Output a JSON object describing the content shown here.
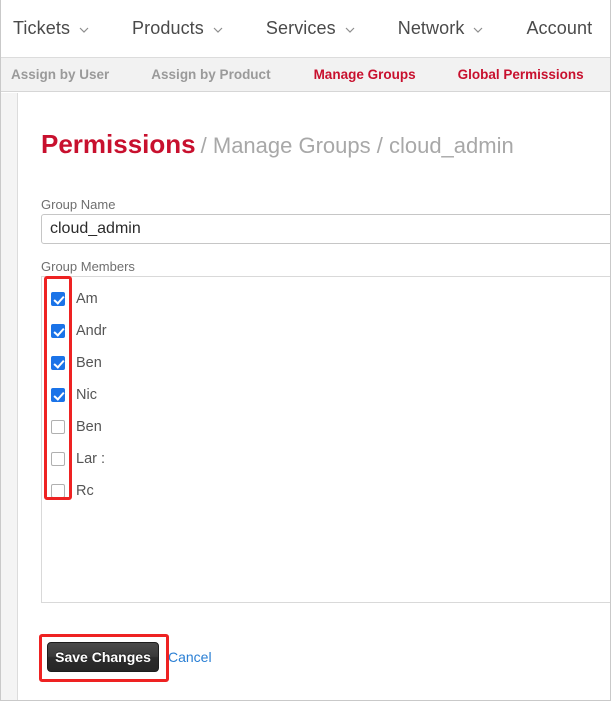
{
  "topnav": {
    "items": [
      {
        "label": "Tickets",
        "has_caret": true,
        "icon": "chevron-down-icon"
      },
      {
        "label": "Products",
        "has_caret": true,
        "icon": "chevron-down-icon"
      },
      {
        "label": "Services",
        "has_caret": true,
        "icon": "chevron-down-icon"
      },
      {
        "label": "Network",
        "has_caret": true,
        "icon": "chevron-down-icon"
      },
      {
        "label": "Account",
        "has_caret": false,
        "icon": ""
      }
    ]
  },
  "subnav": {
    "items": [
      {
        "label": "Assign by User",
        "state": "muted"
      },
      {
        "label": "Assign by Product",
        "state": "muted"
      },
      {
        "label": "Manage Groups",
        "state": "active"
      },
      {
        "label": "Global Permissions",
        "state": "link"
      }
    ]
  },
  "page": {
    "title": "Permissions",
    "breadcrumb": "/ Manage Groups / cloud_admin"
  },
  "form": {
    "group_name_label": "Group Name",
    "group_name_value": "cloud_admin",
    "group_name_placeholder": "Group Name",
    "group_members_label": "Group Members",
    "members": [
      {
        "name": "Am",
        "checked": true
      },
      {
        "name": "Andr",
        "checked": true
      },
      {
        "name": "Ben",
        "checked": true
      },
      {
        "name": "Nic",
        "checked": true
      },
      {
        "name": "Ben ",
        "checked": false
      },
      {
        "name": "Lar  :",
        "checked": false
      },
      {
        "name": "Rc",
        "checked": false
      }
    ]
  },
  "actions": {
    "save_label": "Save Changes",
    "cancel_label": "Cancel"
  },
  "colors": {
    "brand_red": "#c8102e",
    "annotation_red": "#ee2222",
    "checkbox_blue": "#1a73e8",
    "link_blue": "#2a7fd4",
    "muted_gray": "#9a9a9a",
    "subnav_bg": "#f2f2f2"
  }
}
